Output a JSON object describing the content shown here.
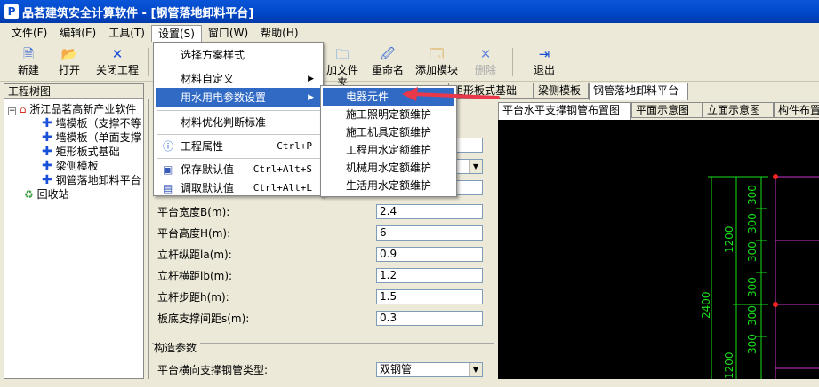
{
  "window": {
    "title": "品茗建筑安全计算软件 - [钢管落地卸料平台]",
    "logo": "P"
  },
  "menubar": [
    "文件(F)",
    "编辑(E)",
    "工具(T)",
    "设置(S)",
    "窗口(W)",
    "帮助(H)"
  ],
  "toolbar": [
    {
      "label": "新建",
      "icon": "new-file-icon"
    },
    {
      "label": "打开",
      "icon": "open-folder-icon"
    },
    {
      "label": "关闭工程",
      "icon": "close-icon"
    },
    {
      "label": "加文件夹",
      "icon": "folder-add-icon"
    },
    {
      "label": "重命名",
      "icon": "rename-icon"
    },
    {
      "label": "添加模块",
      "icon": "add-module-icon"
    },
    {
      "label": "删除",
      "icon": "delete-icon",
      "disabled": true
    },
    {
      "label": "退出",
      "icon": "exit-icon"
    }
  ],
  "tree": {
    "header": "工程树图",
    "root": "浙江品茗高新产业软件",
    "items": [
      "墙模板（支撑不等",
      "墙模板（单面支撑",
      "矩形板式基础",
      "梁侧模板",
      "钢管落地卸料平台"
    ],
    "recycle": "回收站"
  },
  "doc_tabs": [
    "矩形板式基础",
    "梁侧模板",
    "钢管落地卸料平台"
  ],
  "params": [
    {
      "label": "平台宽度B(m):",
      "value": "2.4"
    },
    {
      "label": "平台高度H(m):",
      "value": "6"
    },
    {
      "label": "立杆纵距la(m):",
      "value": "0.9"
    },
    {
      "label": "立杆横距lb(m):",
      "value": "1.2"
    },
    {
      "label": "立杆步距h(m):",
      "value": "1.5"
    },
    {
      "label": "板底支撑间距s(m):",
      "value": "0.3"
    }
  ],
  "group": {
    "title": "构造参数",
    "label": "平台横向支撑钢管类型:",
    "value": "双钢管"
  },
  "view_tabs": [
    "平台水平支撑钢管布置图",
    "平面示意图",
    "立面示意图",
    "构件布置"
  ],
  "drawing": {
    "dims_top": [
      "300",
      "300",
      "300",
      "300"
    ],
    "dims_mid": [
      "1200",
      "2400"
    ],
    "dims_bot": [
      "300",
      "300",
      "300",
      "300",
      "1200"
    ]
  },
  "settings_menu": [
    {
      "label": "选择方案样式"
    },
    {
      "label": "材料自定义",
      "submenu": true
    },
    {
      "label": "用水用电参数设置",
      "submenu": true,
      "highlight": true
    },
    {
      "label": "材料优化判断标准"
    },
    {
      "label": "工程属性",
      "shortcut": "Ctrl+P",
      "icon": "info-icon"
    },
    {
      "label": "保存默认值",
      "shortcut": "Ctrl+Alt+S",
      "icon": "save-icon"
    },
    {
      "label": "调取默认值",
      "shortcut": "Ctrl+Alt+L",
      "icon": "load-icon"
    }
  ],
  "sub_menu": [
    "电器元件",
    "施工照明定额维护",
    "施工机具定额维护",
    "工程用水定额维护",
    "机械用水定额维护",
    "生活用水定额维护"
  ],
  "colors": {
    "titlebar": "#0046c8",
    "highlight": "#316ac5",
    "arrow": "#e8384a",
    "dim_green": "#19e019",
    "grid_magenta": "#cc33cc"
  }
}
